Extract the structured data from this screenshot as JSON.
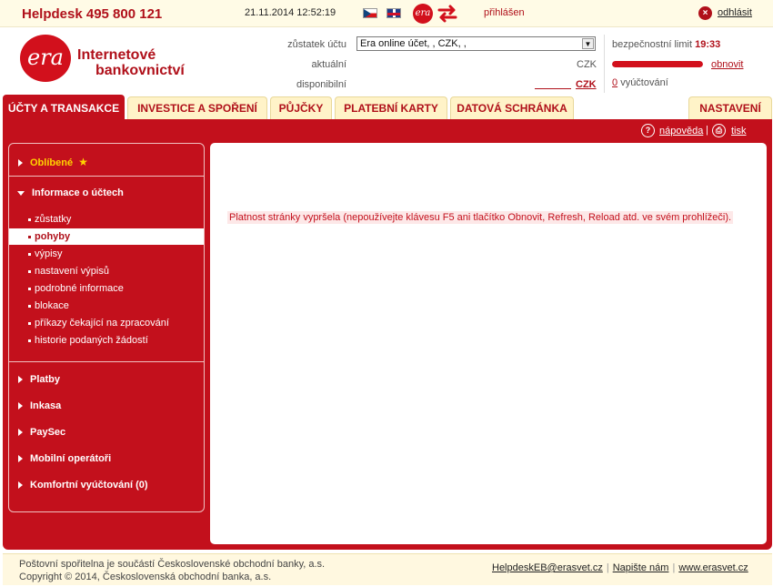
{
  "topbar": {
    "helpdesk": "Helpdesk 495 800 121",
    "datetime": "21.11.2014  12:52:19",
    "era_icon": "era",
    "status": "přihlášen",
    "logout": "odhlásit"
  },
  "header": {
    "logo_circle": "era",
    "logo_line1": "Internetové",
    "logo_line2": "bankovnictví",
    "balance_label": "zůstatek účtu",
    "account_value": "Era online účet,                  , CZK,          ,",
    "current_label": "aktuální",
    "current_currency": "CZK",
    "available_label": "disponibilní",
    "available_currency": "CZK",
    "security_limit_label": "bezpečnostní limit",
    "security_limit_time": "19:33",
    "session_progress": 1.0,
    "refresh": "obnovit",
    "billing_count": "0",
    "billing_label": "vyúčtování"
  },
  "tabs": [
    {
      "label": "ÚČTY A TRANSAKCE",
      "active": true
    },
    {
      "label": "INVESTICE A SPOŘENÍ"
    },
    {
      "label": "PŮJČKY"
    },
    {
      "label": "PLATEBNÍ KARTY"
    },
    {
      "label": "DATOVÁ SCHRÁNKA"
    },
    {
      "label": "NASTAVENÍ"
    }
  ],
  "toolbar": {
    "help": "nápověda",
    "print": "tisk"
  },
  "sidebar": {
    "favorites": "Oblíbené",
    "account_info": "Informace o účtech",
    "items": [
      "zůstatky",
      "pohyby",
      "výpisy",
      "nastavení výpisů",
      "podrobné informace",
      "blokace",
      "příkazy čekající na zpracování",
      "historie podaných žádostí"
    ],
    "active_item": "pohyby",
    "sections": [
      "Platby",
      "Inkasa",
      "PaySec",
      "Mobilní operátoři",
      "Komfortní vyúčtování (0)"
    ]
  },
  "content": {
    "message": "Platnost stránky vypršela (nepoužívejte klávesu F5 ani tlačítko Obnovit, Refresh, Reload atd. ve svém prohlížeči)."
  },
  "footer": {
    "line1": "Poštovní spořitelna je součástí Československé obchodní banky, a.s.",
    "line2": "Copyright © 2014, Československá obchodní banka, a.s.",
    "email": "HelpdeskEB@erasvet.cz",
    "write_us": "Napište nám",
    "website": "www.erasvet.cz"
  },
  "colors": {
    "brand_red": "#c3101c",
    "tab_bg": "#fff3c8",
    "favorite_star": "#ffd400"
  },
  "icons": [
    "cz-flag-icon",
    "uk-flag-icon",
    "era-icon",
    "swap-arrows-icon",
    "logout-icon",
    "help-icon",
    "print-icon",
    "star-icon"
  ]
}
